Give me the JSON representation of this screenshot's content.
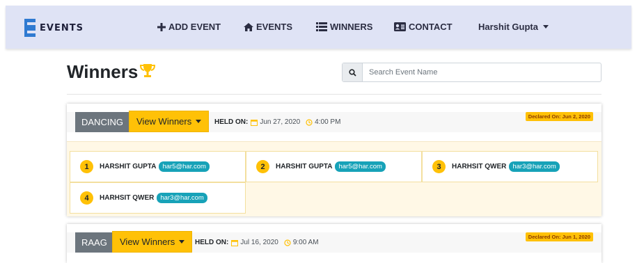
{
  "nav": {
    "brand": "EVENTS",
    "items": [
      {
        "label": "ADD EVENT",
        "icon": "plus-icon"
      },
      {
        "label": "EVENTS",
        "icon": "home-icon"
      },
      {
        "label": "WINNERS",
        "icon": "list-icon"
      },
      {
        "label": "CONTACT",
        "icon": "address-card-icon"
      }
    ],
    "user": "Harshit Gupta"
  },
  "page": {
    "title": "Winners",
    "title_icon": "trophy-icon"
  },
  "search": {
    "placeholder": "Search Event Name",
    "icon": "search-icon"
  },
  "events": [
    {
      "category": "DANCING",
      "view_label": "View Winners",
      "held_label": "HELD ON:",
      "date": "Jun 27, 2020",
      "time": "4:00 PM",
      "declared": "Declared On: Jun 2, 2020",
      "winners": [
        {
          "rank": "1",
          "name": "HARSHIT GUPTA",
          "email": "har5@har.com"
        },
        {
          "rank": "2",
          "name": "HARSHIT GUPTA",
          "email": "har5@har.com"
        },
        {
          "rank": "3",
          "name": "HARHSIT QWER",
          "email": "har3@har.com"
        },
        {
          "rank": "4",
          "name": "HARHSIT QWER",
          "email": "har3@har.com"
        }
      ]
    },
    {
      "category": "RAAG",
      "view_label": "View Winners",
      "held_label": "HELD ON:",
      "date": "Jul 16, 2020",
      "time": "9:00 AM",
      "declared": "Declared On: Jun 1, 2020"
    }
  ],
  "colors": {
    "navbar_bg": "#dfe3f5",
    "brand_blue": "#2f7ad1",
    "warning_yellow": "#ffc107",
    "badge_gray": "#6c757d",
    "email_badge": "#17a2b8",
    "winners_bg": "#fff8e6"
  }
}
